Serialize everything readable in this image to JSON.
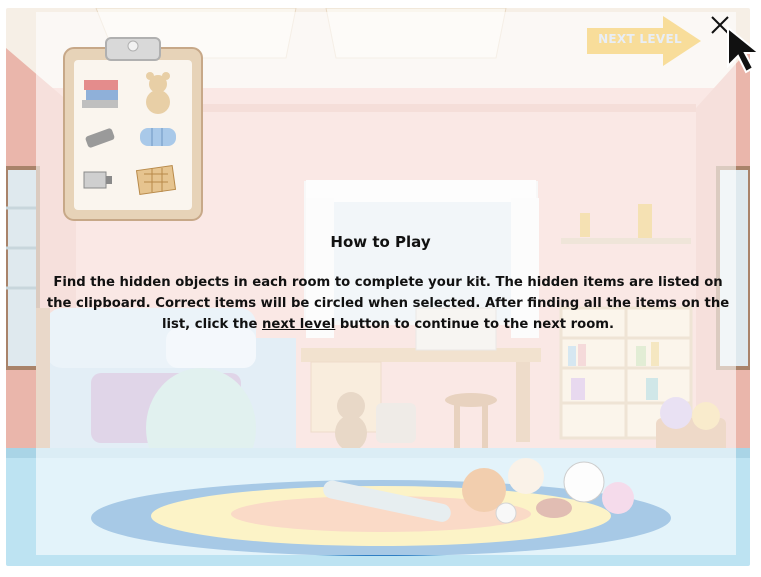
{
  "dialog": {
    "title": "How to Play",
    "text_part1": "Find the hidden objects in each room to complete your kit. The hidden items are listed on the clipboard. Correct items will be circled when selected. After finding all the items on the list, click the ",
    "text_link": "next level",
    "text_part2": " button to continue to the next room."
  },
  "next_level_button": {
    "label": "NEXT LEVEL"
  },
  "clipboard": {
    "items": [
      "books-and-clothes",
      "teddy-bear",
      "phone",
      "sleeping-bag",
      "battery",
      "board-game"
    ]
  },
  "colors": {
    "arrow_fill": "#f7d88a",
    "dialog_backdrop": "rgba(255,255,255,0.58)",
    "wall": "#f2c9c0",
    "floor": "#bde3f2"
  }
}
